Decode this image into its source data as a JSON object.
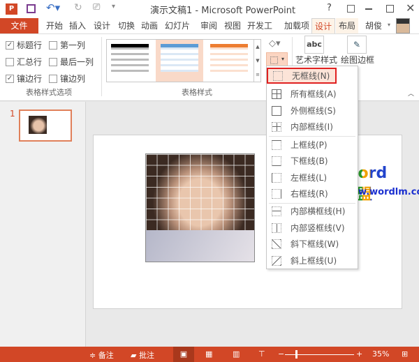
{
  "title": "演示文稿1 - Microsoft PowerPoint",
  "help": "?",
  "tabs": [
    "文件",
    "开始",
    "插入",
    "设计",
    "切换",
    "动画",
    "幻灯片",
    "审阅",
    "视图",
    "开发工",
    "加载项",
    "设计",
    "布局"
  ],
  "user": "胡俊",
  "options": {
    "header_row": "标题行",
    "first_col": "第一列",
    "total_row": "汇总行",
    "last_col": "最后一列",
    "banded_rows": "镶边行",
    "banded_cols": "镶边列",
    "group": "表格样式选项"
  },
  "styles": {
    "group": "表格样式",
    "wordart": "艺术字样式",
    "wordart_icon": "abc",
    "draw": "绘图边框"
  },
  "styles_gallery_colors": [
    "#000000",
    "#5b9bd5",
    "#ed7d31"
  ],
  "menu": [
    "无框线(N)",
    "所有框线(A)",
    "外侧框线(S)",
    "内部框线(I)",
    "上框线(P)",
    "下框线(B)",
    "左框线(L)",
    "右框线(R)",
    "内部横框线(H)",
    "内部竖框线(V)",
    "斜下框线(W)",
    "斜上框线(U)"
  ],
  "slide_number": "1",
  "watermark": {
    "brand": "Word联盟",
    "url": "www.wordlm.com"
  },
  "status": {
    "notes": "备注",
    "comments": "批注",
    "zoom": "35%"
  },
  "accent": "#d24726"
}
